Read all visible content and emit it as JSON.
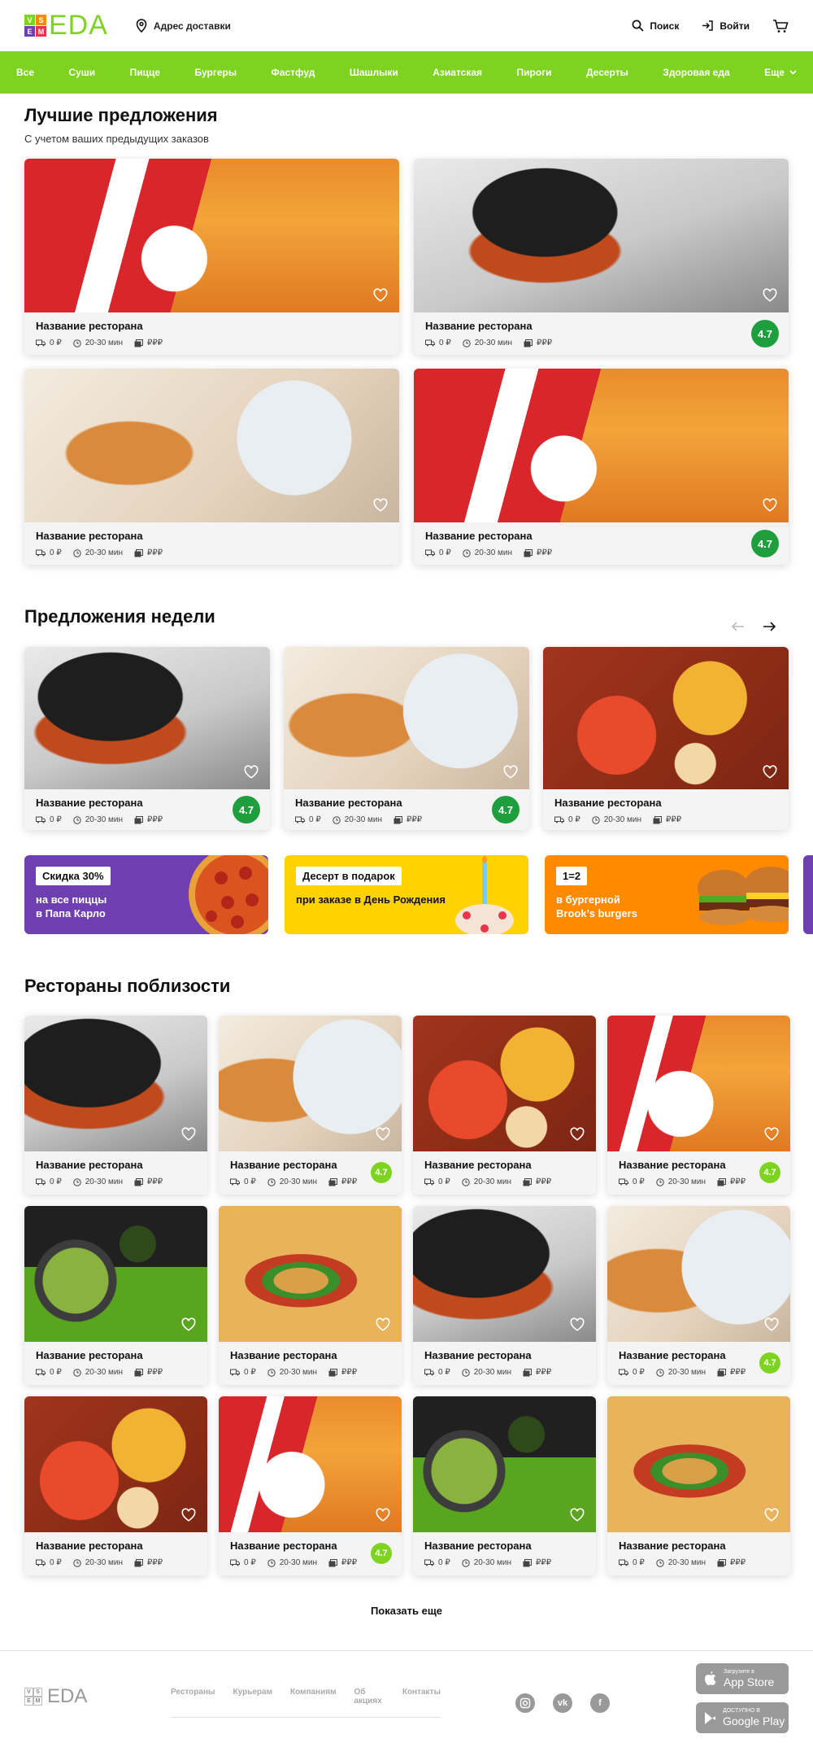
{
  "header": {
    "logo_letters": [
      "V",
      "S",
      "E",
      "M"
    ],
    "logo_text": "EDA",
    "address_label": "Адрес доставки",
    "search_label": "Поиск",
    "login_label": "Войти"
  },
  "colors": {
    "accent": "#7ed321",
    "rating_dark": "#1f9e3e",
    "rating_light": "#7ed321",
    "promo_purple": "#6e3fb1",
    "promo_yellow": "#ffd200",
    "promo_orange": "#ff8a00"
  },
  "nav": {
    "items": [
      "Все",
      "Суши",
      "Пицце",
      "Бургеры",
      "Фастфуд",
      "Шашлыки",
      "Азиатская",
      "Пироги",
      "Десерты",
      "Здоровая еда",
      "Еще"
    ]
  },
  "best": {
    "title": "Лучшие предложения",
    "subtitle": "С учетом ваших предыдущих заказов",
    "cards": [
      {
        "name": "Название ресторана",
        "delivery": "0 ₽",
        "time": "20-30 мин",
        "price": "₽₽₽",
        "rating": "",
        "image": "kfc"
      },
      {
        "name": "Название ресторана",
        "delivery": "0 ₽",
        "time": "20-30 мин",
        "price": "₽₽₽",
        "rating": "4.7",
        "image": "burger"
      },
      {
        "name": "Название ресторана",
        "delivery": "0 ₽",
        "time": "20-30 мин",
        "price": "₽₽₽",
        "rating": "",
        "image": "coffee"
      },
      {
        "name": "Название ресторана",
        "delivery": "0 ₽",
        "time": "20-30 мин",
        "price": "₽₽₽",
        "rating": "4.7",
        "image": "kfc"
      }
    ]
  },
  "week": {
    "title": "Предложения недели",
    "cards": [
      {
        "name": "Название ресторана",
        "delivery": "0 ₽",
        "time": "20-30 мин",
        "price": "₽₽₽",
        "rating": "4.7",
        "image": "burger"
      },
      {
        "name": "Название ресторана",
        "delivery": "0 ₽",
        "time": "20-30 мин",
        "price": "₽₽₽",
        "rating": "4.7",
        "image": "coffee"
      },
      {
        "name": "Название ресторана",
        "delivery": "0 ₽",
        "time": "20-30 мин",
        "price": "₽₽₽",
        "rating": "",
        "image": "asian"
      }
    ],
    "promos": [
      {
        "tag": "Скидка 30%",
        "text": "на все пиццы\nв Папа Карло",
        "color": "purple"
      },
      {
        "tag": "Десерт в подарок",
        "text": "при заказе в День Рождения",
        "color": "yellow"
      },
      {
        "tag": "1=2",
        "text": "в бургерной\nBrook’s burgers",
        "color": "orange"
      }
    ]
  },
  "nearby": {
    "title": "Рестораны поблизости",
    "cards": [
      {
        "name": "Название ресторана",
        "delivery": "0 ₽",
        "time": "20-30 мин",
        "price": "₽₽₽",
        "rating": "",
        "image": "burger"
      },
      {
        "name": "Название ресторана",
        "delivery": "0 ₽",
        "time": "20-30 мин",
        "price": "₽₽₽",
        "rating": "4.7",
        "image": "coffee"
      },
      {
        "name": "Название ресторана",
        "delivery": "0 ₽",
        "time": "20-30 мин",
        "price": "₽₽₽",
        "rating": "",
        "image": "asian"
      },
      {
        "name": "Название ресторана",
        "delivery": "0 ₽",
        "time": "20-30 мин",
        "price": "₽₽₽",
        "rating": "4.7",
        "image": "kfc"
      },
      {
        "name": "Название ресторана",
        "delivery": "0 ₽",
        "time": "20-30 мин",
        "price": "₽₽₽",
        "rating": "",
        "image": "matcha"
      },
      {
        "name": "Название ресторана",
        "delivery": "0 ₽",
        "time": "20-30 мин",
        "price": "₽₽₽",
        "rating": "",
        "image": "bk"
      },
      {
        "name": "Название ресторана",
        "delivery": "0 ₽",
        "time": "20-30 мин",
        "price": "₽₽₽",
        "rating": "",
        "image": "burger"
      },
      {
        "name": "Название ресторана",
        "delivery": "0 ₽",
        "time": "20-30 мин",
        "price": "₽₽₽",
        "rating": "4.7",
        "image": "coffee"
      },
      {
        "name": "Название ресторана",
        "delivery": "0 ₽",
        "time": "20-30 мин",
        "price": "₽₽₽",
        "rating": "",
        "image": "asian"
      },
      {
        "name": "Название ресторана",
        "delivery": "0 ₽",
        "time": "20-30 мин",
        "price": "₽₽₽",
        "rating": "4.7",
        "image": "kfc"
      },
      {
        "name": "Название ресторана",
        "delivery": "0 ₽",
        "time": "20-30 мин",
        "price": "₽₽₽",
        "rating": "",
        "image": "matcha"
      },
      {
        "name": "Название ресторана",
        "delivery": "0 ₽",
        "time": "20-30 мин",
        "price": "₽₽₽",
        "rating": "",
        "image": "bk"
      }
    ]
  },
  "show_more": "Показать еще",
  "footer": {
    "logo_text": "EDA",
    "links": [
      "Рестораны",
      "Курьерам",
      "Компаниям",
      "Об акциях",
      "Контакты"
    ],
    "social": [
      "instagram-icon",
      "vk-icon",
      "facebook-icon"
    ],
    "appstore_small": "Загрузите в",
    "appstore_big": "App Store",
    "googleplay_small": "ДОСТУПНО В",
    "googleplay_big": "Google Play"
  }
}
